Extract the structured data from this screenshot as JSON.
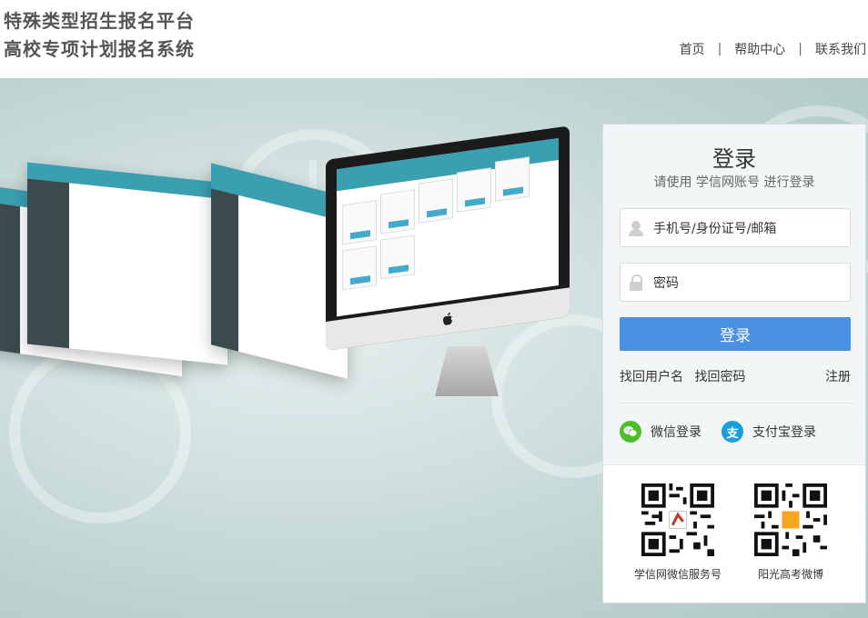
{
  "header": {
    "title_line1": "特殊类型招生报名平台",
    "title_line2": "高校专项计划报名系统",
    "nav": [
      "首页",
      "帮助中心",
      "联系我们"
    ],
    "separator": "|"
  },
  "login": {
    "title": "登录",
    "subtitle": "请使用 学信网账号 进行登录",
    "username_placeholder": "手机号/身份证号/邮箱",
    "password_placeholder": "密码",
    "button": "登录",
    "forgot_username": "找回用户名",
    "forgot_password": "找回密码",
    "register": "注册",
    "wechat_login": "微信登录",
    "alipay_login": "支付宝登录",
    "alipay_glyph": "支"
  },
  "qr": {
    "wechat_label": "学信网微信服务号",
    "weibo_label": "阳光高考微博"
  },
  "colors": {
    "accent": "#4a90e2",
    "wechat": "#4cbf2a",
    "alipay": "#1a9ee0",
    "header_screens": "#3a9fb1"
  }
}
